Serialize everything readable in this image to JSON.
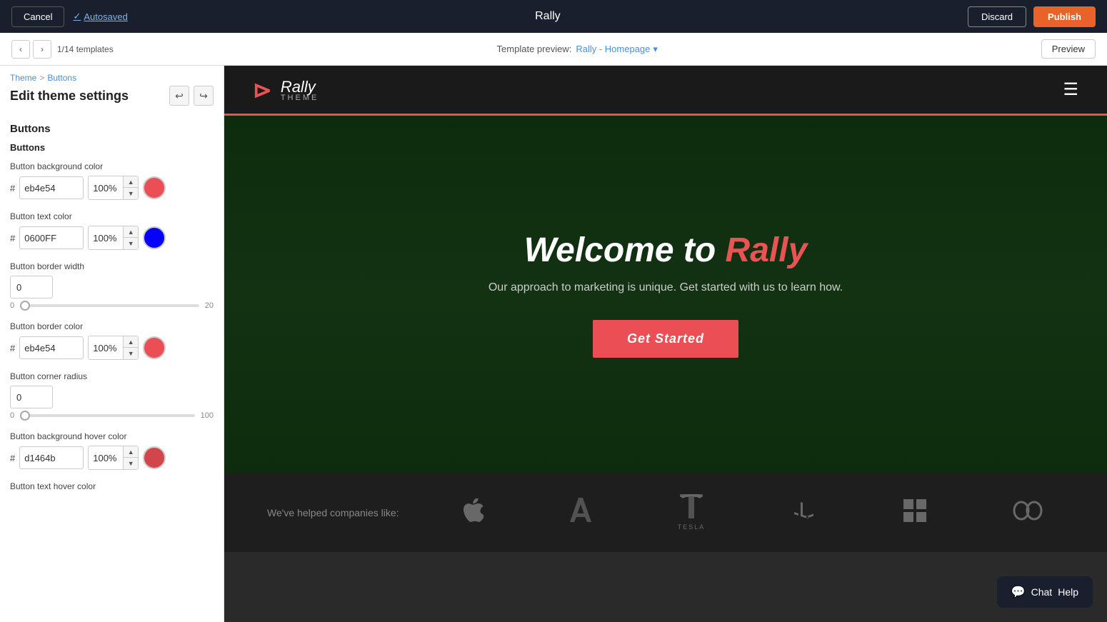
{
  "topbar": {
    "cancel_label": "Cancel",
    "autosaved_label": "Autosaved",
    "title": "Rally",
    "discard_label": "Discard",
    "publish_label": "Publish"
  },
  "secondbar": {
    "template_count": "1/14 templates",
    "template_preview_label": "Template preview:",
    "template_name": "Rally - Homepage",
    "preview_label": "Preview",
    "nav_prev": "‹",
    "nav_next": "›"
  },
  "sidebar": {
    "breadcrumb_theme": "Theme",
    "breadcrumb_separator": ">",
    "breadcrumb_buttons": "Buttons",
    "title": "Edit theme settings",
    "undo_icon": "↩",
    "redo_icon": "↪",
    "sections": [
      {
        "title": "Buttons",
        "subsection": "Buttons",
        "fields": [
          {
            "label": "Button background color",
            "hash": "#",
            "hex_value": "eb4e54",
            "opacity_value": "100%",
            "swatch_color": "#eb4e54"
          },
          {
            "label": "Button text color",
            "hash": "#",
            "hex_value": "0600FF",
            "opacity_value": "100%",
            "swatch_color": "#0600FF"
          },
          {
            "label": "Button border width",
            "number_value": "0",
            "slider_min": "0",
            "slider_max": "20",
            "slider_value": 0
          },
          {
            "label": "Button border color",
            "hash": "#",
            "hex_value": "eb4e54",
            "opacity_value": "100%",
            "swatch_color": "#eb4e54"
          },
          {
            "label": "Button corner radius",
            "number_value": "0",
            "slider_min": "0",
            "slider_max": "100",
            "slider_value": 0
          },
          {
            "label": "Button background hover color",
            "hash": "#",
            "hex_value": "d1464b",
            "opacity_value": "100%",
            "swatch_color": "#d1464b"
          },
          {
            "label": "Button text hover color"
          }
        ]
      }
    ]
  },
  "preview": {
    "nav": {
      "logo_icon": "≡",
      "logo_text": "Rally",
      "logo_sub": "THEME",
      "hamburger": "☰"
    },
    "hero": {
      "title_part1": "Welcome to ",
      "title_highlight": "Rally",
      "subtitle": "Our approach to marketing is unique. Get started with us to learn how.",
      "cta_label": "Get Started"
    },
    "logos": {
      "label": "We've helped companies like:",
      "items": [
        "🍎",
        "A",
        "T",
        "Ⓟ",
        "⊞",
        "◯"
      ]
    }
  },
  "chat_help": {
    "icon": "💬",
    "chat_label": "Chat",
    "help_label": "Help"
  }
}
